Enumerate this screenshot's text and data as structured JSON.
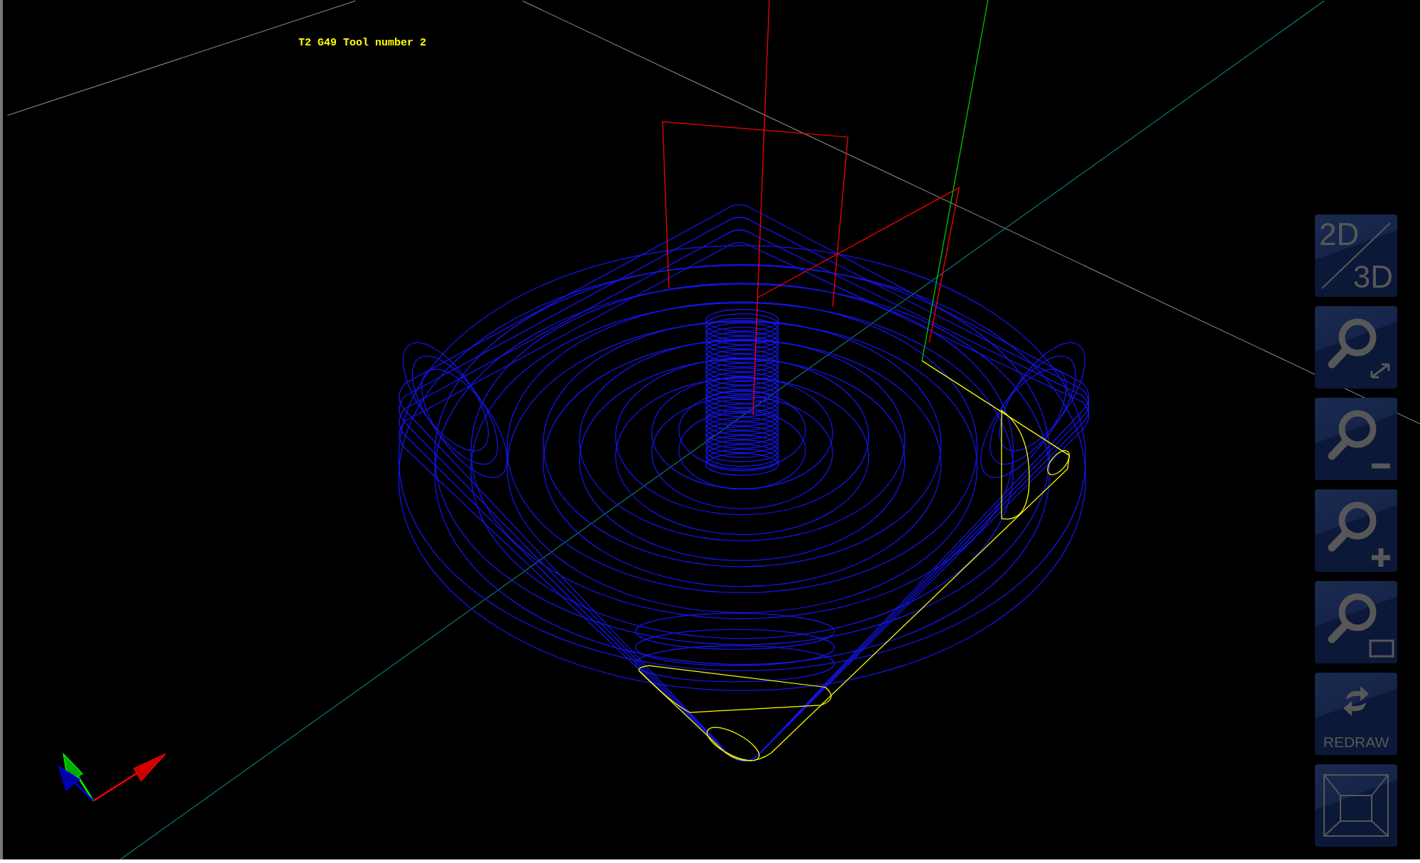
{
  "status_text": "T2 G49 Tool number 2",
  "toolbar": [
    {
      "kind": "toggle-2d-3d",
      "labels": [
        "2D",
        "3D"
      ]
    },
    {
      "kind": "zoom-fit"
    },
    {
      "kind": "zoom-out"
    },
    {
      "kind": "zoom-in"
    },
    {
      "kind": "zoom-window"
    },
    {
      "kind": "redraw",
      "label": "REDRAW"
    },
    {
      "kind": "view-box"
    }
  ]
}
